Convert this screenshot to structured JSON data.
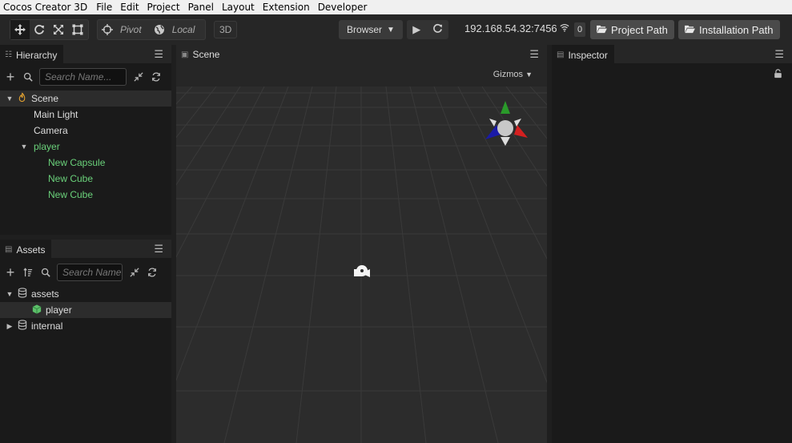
{
  "menubar": {
    "app_title": "Cocos Creator 3D",
    "items": [
      "File",
      "Edit",
      "Project",
      "Panel",
      "Layout",
      "Extension",
      "Developer"
    ]
  },
  "toolbar": {
    "pivot_label": "Pivot",
    "local_label": "Local",
    "mode_3d": "3D",
    "browser_label": "Browser",
    "ip_address": "192.168.54.32:7456",
    "device_count": "0",
    "project_path_label": "Project Path",
    "installation_path_label": "Installation Path"
  },
  "hierarchy": {
    "title": "Hierarchy",
    "search_placeholder": "Search Name...",
    "nodes": {
      "scene": "Scene",
      "main_light": "Main Light",
      "camera": "Camera",
      "player": "player",
      "new_capsule": "New Capsule",
      "new_cube_1": "New Cube",
      "new_cube_2": "New Cube"
    }
  },
  "assets": {
    "title": "Assets",
    "search_placeholder": "Search Name...",
    "items": {
      "assets": "assets",
      "player": "player",
      "internal": "internal"
    }
  },
  "scene": {
    "title": "Scene",
    "gizmos_label": "Gizmos"
  },
  "inspector": {
    "title": "Inspector"
  },
  "colors": {
    "accent_green": "#6ad17a",
    "axis_x": "#d42020",
    "axis_y": "#2a9a2a",
    "axis_z": "#1a1aa8"
  }
}
